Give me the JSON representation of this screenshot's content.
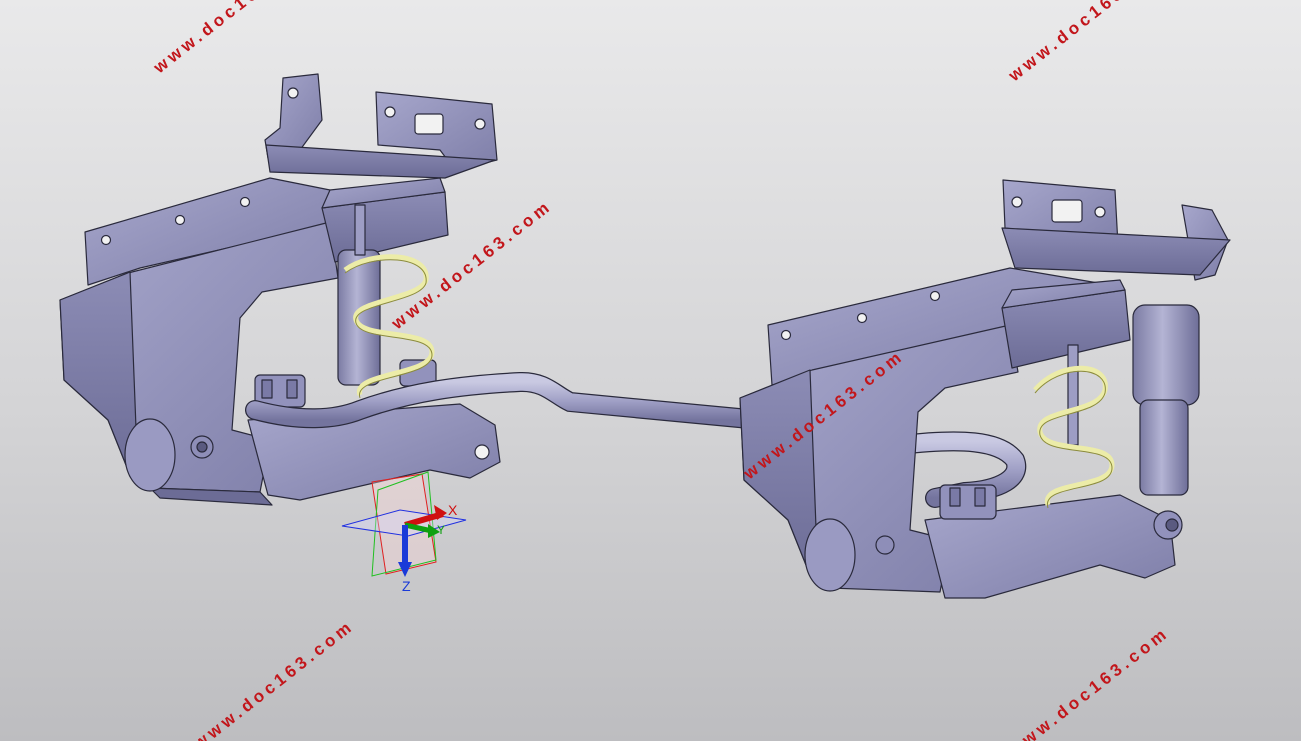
{
  "watermark": {
    "text": "www.doc163.com",
    "color": "#c2161b"
  },
  "compass": {
    "x_label": "X",
    "y_label": "Y",
    "z_label": "Z",
    "x_color": "#d01010",
    "y_color": "#0fa010",
    "z_color": "#1a3ad8"
  },
  "model": {
    "part_color": "#8a8ab4",
    "spring_color": "#ececa8",
    "edge_color": "#2a2a3c"
  }
}
